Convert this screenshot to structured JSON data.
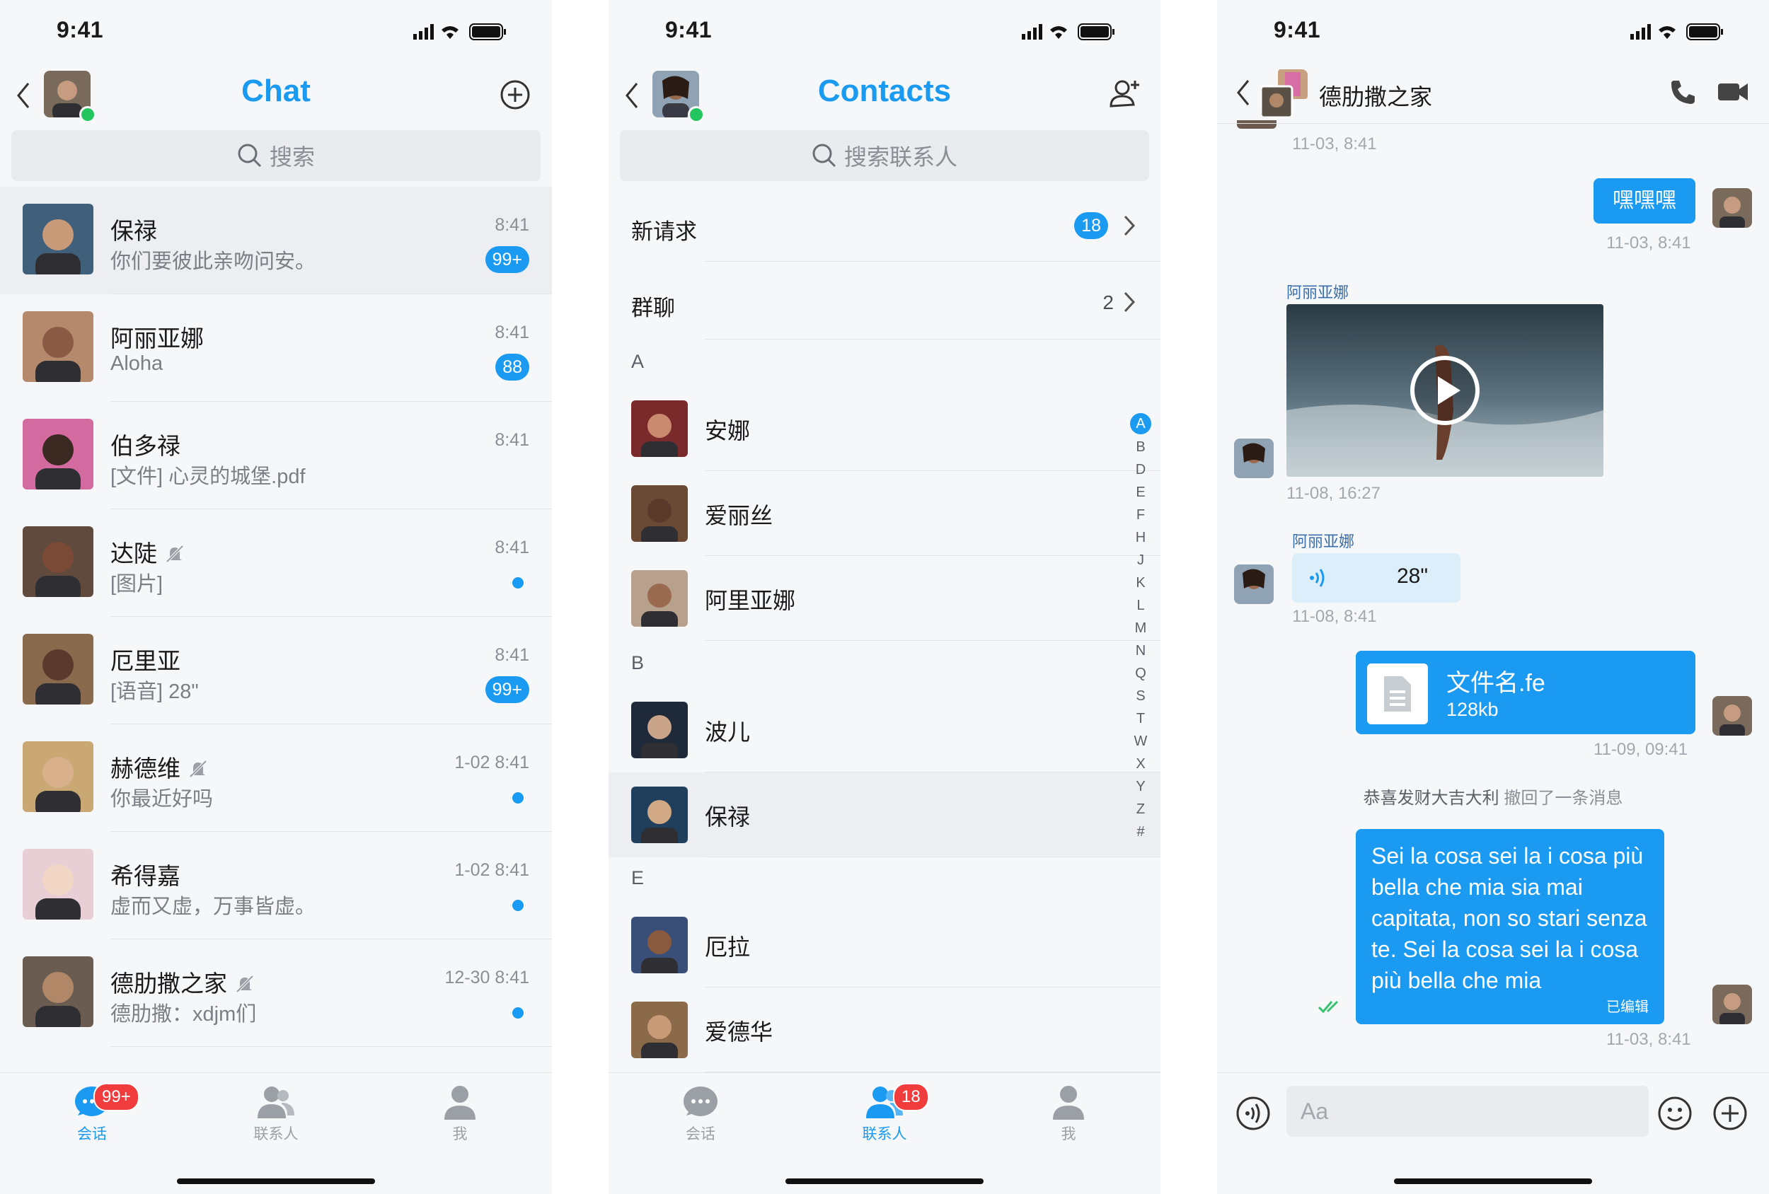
{
  "colors": {
    "accent": "#1a9af0",
    "badge_red": "#f03c3c",
    "online": "#22c55e"
  },
  "status": {
    "time": "9:41"
  },
  "chat_screen": {
    "title": "Chat",
    "search_placeholder": "搜索",
    "items": [
      {
        "name": "保禄",
        "preview": "你们要彼此亲吻问安。",
        "time": "8:41",
        "badge": "99+",
        "muted": false
      },
      {
        "name": "阿丽亚娜",
        "preview": "Aloha",
        "time": "8:41",
        "badge": "88",
        "muted": false
      },
      {
        "name": "伯多禄",
        "preview": "[文件] 心灵的城堡.pdf",
        "time": "8:41",
        "badge": "",
        "muted": false
      },
      {
        "name": "达陡",
        "preview": "[图片]",
        "time": "8:41",
        "badge": "",
        "muted": true
      },
      {
        "name": "厄里亚",
        "preview": "[语音] 28\"",
        "time": "8:41",
        "badge": "99+",
        "muted": false
      },
      {
        "name": "赫德维",
        "preview": "你最近好吗",
        "time": "1-02 8:41",
        "badge": "",
        "muted": true
      },
      {
        "name": "希得嘉",
        "preview": "虚而又虚，万事皆虚。",
        "time": "1-02 8:41",
        "badge": "",
        "muted": false
      },
      {
        "name": "德肋撒之家",
        "preview": "德肋撒：xdjm们",
        "time": "12-30 8:41",
        "badge": "",
        "muted": true
      }
    ],
    "tabs": [
      {
        "label": "会话",
        "badge": "99+"
      },
      {
        "label": "联系人",
        "badge": ""
      },
      {
        "label": "我",
        "badge": ""
      }
    ]
  },
  "contacts_screen": {
    "title": "Contacts",
    "search_placeholder": "搜索联系人",
    "new_requests": {
      "label": "新请求",
      "count": "18"
    },
    "groups": {
      "label": "群聊",
      "count": "2"
    },
    "sections": [
      {
        "letter": "A",
        "contacts": [
          "安娜",
          "爱丽丝",
          "阿里亚娜"
        ]
      },
      {
        "letter": "B",
        "contacts": [
          "波儿",
          "保禄"
        ]
      },
      {
        "letter": "E",
        "contacts": [
          "厄拉",
          "爱德华"
        ]
      }
    ],
    "index": [
      "A",
      "B",
      "D",
      "E",
      "F",
      "H",
      "J",
      "K",
      "L",
      "M",
      "N",
      "Q",
      "S",
      "T",
      "W",
      "X",
      "Y",
      "Z",
      "#"
    ],
    "tabs": [
      {
        "label": "会话",
        "badge": ""
      },
      {
        "label": "联系人",
        "badge": "18"
      },
      {
        "label": "我",
        "badge": ""
      }
    ]
  },
  "conversation_screen": {
    "title": "德肋撒之家",
    "messages": {
      "top_time": "11-03, 8:41",
      "m1_text": "嘿嘿嘿",
      "m1_time": "11-03, 8:41",
      "m2_sender": "阿丽亚娜",
      "m2_time": "11-08, 16:27",
      "m3_sender": "阿丽亚娜",
      "m3_duration": "28\"",
      "m3_time": "11-08, 8:41",
      "m4_filename": "文件名.fe",
      "m4_size": "128kb",
      "m4_time": "11-09, 09:41",
      "recall_name": "恭喜发财大吉大利",
      "recall_text": "撤回了一条消息",
      "m5_text": "Sei la cosa sei la i cosa più bella che mia sia mai capitata, non so stari senza te. Sei la cosa sei la i cosa più bella che mia",
      "m5_edited": "已编辑",
      "m5_time": "11-03, 8:41"
    },
    "input_placeholder": "Aa"
  }
}
